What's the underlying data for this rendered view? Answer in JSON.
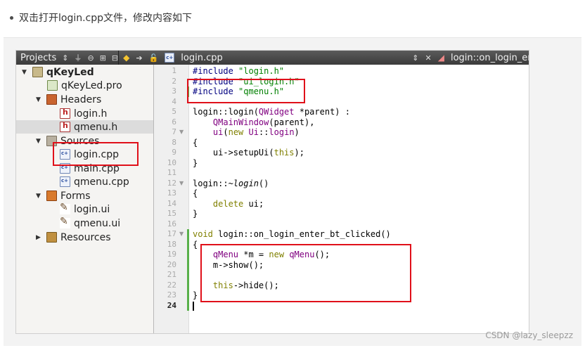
{
  "instruction": {
    "text": "双击打开login.cpp文件，修改内容如下"
  },
  "toolbar": {
    "projects_label": "Projects",
    "file_label": "login.cpp",
    "symbol_label": "login::on_login_enter"
  },
  "tree": {
    "project": "qKeyLed",
    "pro_file": "qKeyLed.pro",
    "headers_label": "Headers",
    "header_files": [
      "login.h",
      "qmenu.h"
    ],
    "sources_label": "Sources",
    "source_files": [
      "login.cpp",
      "main.cpp",
      "qmenu.cpp"
    ],
    "forms_label": "Forms",
    "form_files": [
      "login.ui",
      "qmenu.ui"
    ],
    "resources_label": "Resources"
  },
  "editor": {
    "line_numbers": [
      "1",
      "2",
      "3",
      "4",
      "5",
      "6",
      "7",
      "8",
      "9",
      "10",
      "11",
      "12",
      "13",
      "14",
      "15",
      "16",
      "17",
      "18",
      "19",
      "20",
      "21",
      "22",
      "23",
      "24"
    ],
    "current_line": "24",
    "lines": [
      [
        {
          "t": "#include ",
          "c": "pp"
        },
        {
          "t": "\"login.h\"",
          "c": "str"
        }
      ],
      [
        {
          "t": "#include ",
          "c": "pp"
        },
        {
          "t": "\"ui_login.h\"",
          "c": "str"
        }
      ],
      [
        {
          "t": "#include ",
          "c": "pp"
        },
        {
          "t": "\"qmenu.h\"",
          "c": "str"
        }
      ],
      [],
      [
        {
          "t": "login::login(",
          "c": ""
        },
        {
          "t": "QWidget",
          "c": "ty"
        },
        {
          "t": " *parent) :",
          "c": ""
        }
      ],
      [
        {
          "t": "    ",
          "c": ""
        },
        {
          "t": "QMainWindow",
          "c": "ty"
        },
        {
          "t": "(parent),",
          "c": ""
        }
      ],
      [
        {
          "t": "    ",
          "c": ""
        },
        {
          "t": "ui",
          "c": "ty"
        },
        {
          "t": "(",
          "c": ""
        },
        {
          "t": "new",
          "c": "kw"
        },
        {
          "t": " ",
          "c": ""
        },
        {
          "t": "Ui",
          "c": "ty"
        },
        {
          "t": "::",
          "c": ""
        },
        {
          "t": "login",
          "c": "ty"
        },
        {
          "t": ")",
          "c": ""
        }
      ],
      [
        {
          "t": "{",
          "c": ""
        }
      ],
      [
        {
          "t": "    ui->setupUi(",
          "c": ""
        },
        {
          "t": "this",
          "c": "kw"
        },
        {
          "t": ");",
          "c": ""
        }
      ],
      [
        {
          "t": "}",
          "c": ""
        }
      ],
      [],
      [
        {
          "t": "login::~",
          "c": ""
        },
        {
          "t": "login",
          "c": "it"
        },
        {
          "t": "()",
          "c": ""
        }
      ],
      [
        {
          "t": "{",
          "c": ""
        }
      ],
      [
        {
          "t": "    ",
          "c": ""
        },
        {
          "t": "delete",
          "c": "kw"
        },
        {
          "t": " ui;",
          "c": ""
        }
      ],
      [
        {
          "t": "}",
          "c": ""
        }
      ],
      [],
      [
        {
          "t": "void",
          "c": "kw"
        },
        {
          "t": " login::on_login_enter_bt_clicked()",
          "c": ""
        }
      ],
      [
        {
          "t": "{",
          "c": ""
        }
      ],
      [
        {
          "t": "    ",
          "c": ""
        },
        {
          "t": "qMenu",
          "c": "ty"
        },
        {
          "t": " *m = ",
          "c": ""
        },
        {
          "t": "new",
          "c": "kw"
        },
        {
          "t": " ",
          "c": ""
        },
        {
          "t": "qMenu",
          "c": "ty"
        },
        {
          "t": "();",
          "c": ""
        }
      ],
      [
        {
          "t": "    m->show();",
          "c": ""
        }
      ],
      [],
      [
        {
          "t": "    ",
          "c": ""
        },
        {
          "t": "this",
          "c": "kw"
        },
        {
          "t": "->hide();",
          "c": ""
        }
      ],
      [
        {
          "t": "}",
          "c": ""
        }
      ],
      []
    ]
  },
  "watermark": {
    "text": "CSDN @lazy_sleepzz"
  },
  "colors": {
    "highlight_box": "#e0101a",
    "change_bar": "#59b04a"
  }
}
